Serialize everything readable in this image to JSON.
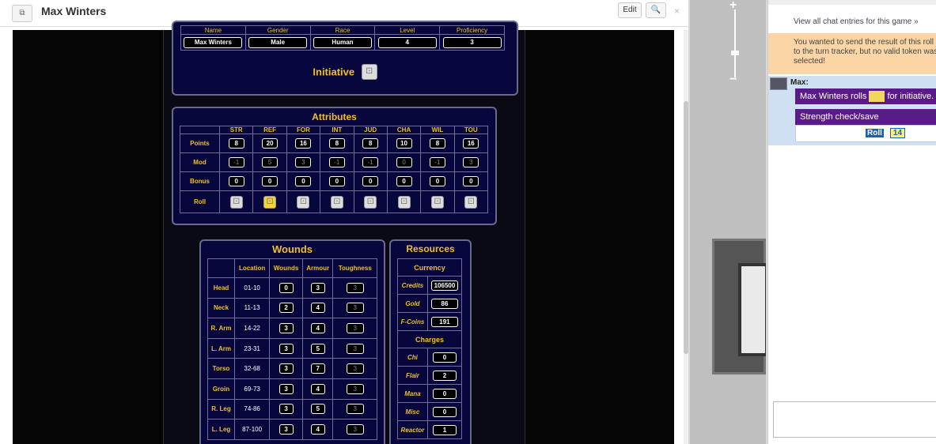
{
  "window": {
    "title": "Max Winters",
    "popout_icon": "⧉",
    "edit_label": "Edit",
    "search_icon": "🔍",
    "close_label": "×"
  },
  "character": {
    "headers": [
      "Name",
      "Gender",
      "Race",
      "Level",
      "Proficiency"
    ],
    "values": [
      "Max Winters",
      "Male",
      "Human",
      "4",
      "3"
    ],
    "initiative_label": "Initiative"
  },
  "attributes": {
    "title": "Attributes",
    "columns": [
      "STR",
      "REF",
      "FOR",
      "INT",
      "JUD",
      "CHA",
      "WIL",
      "TOU"
    ],
    "rows": [
      {
        "label": "Points",
        "values": [
          "8",
          "20",
          "16",
          "8",
          "8",
          "10",
          "8",
          "16"
        ]
      },
      {
        "label": "Mod",
        "values": [
          "-1",
          "5",
          "3",
          "-1",
          "-1",
          "0",
          "-1",
          "3"
        ]
      },
      {
        "label": "Bonus",
        "values": [
          "0",
          "0",
          "0",
          "0",
          "0",
          "0",
          "0",
          "0"
        ]
      }
    ],
    "roll_label": "Roll"
  },
  "wounds": {
    "title": "Wounds",
    "headers": [
      "Location",
      "Wounds",
      "Armour",
      "Toughness"
    ],
    "rows": [
      {
        "part": "Head",
        "loc": "01-10",
        "wounds": "0",
        "armour": "3",
        "tough": "3"
      },
      {
        "part": "Neck",
        "loc": "11-13",
        "wounds": "2",
        "armour": "4",
        "tough": "3"
      },
      {
        "part": "R. Arm",
        "loc": "14-22",
        "wounds": "3",
        "armour": "4",
        "tough": "3"
      },
      {
        "part": "L. Arm",
        "loc": "23-31",
        "wounds": "3",
        "armour": "5",
        "tough": "3"
      },
      {
        "part": "Torso",
        "loc": "32-68",
        "wounds": "3",
        "armour": "7",
        "tough": "3"
      },
      {
        "part": "Groin",
        "loc": "69-73",
        "wounds": "3",
        "armour": "4",
        "tough": "3"
      },
      {
        "part": "R. Leg",
        "loc": "74-86",
        "wounds": "3",
        "armour": "5",
        "tough": "3"
      },
      {
        "part": "L. Leg",
        "loc": "87-100",
        "wounds": "3",
        "armour": "4",
        "tough": "3"
      }
    ]
  },
  "resources": {
    "title": "Resources",
    "currency_header": "Currency",
    "currency": [
      {
        "label": "Credits",
        "value": "106500"
      },
      {
        "label": "Gold",
        "value": "86"
      },
      {
        "label": "F-Coins",
        "value": "191"
      }
    ],
    "charges_header": "Charges",
    "charges": [
      {
        "label": "Chi",
        "value": "0"
      },
      {
        "label": "Flair",
        "value": "2"
      },
      {
        "label": "Mana",
        "value": "0"
      },
      {
        "label": "Misc",
        "value": "0"
      },
      {
        "label": "Reactor",
        "value": "1"
      }
    ]
  },
  "map": {
    "zoom_in": "+",
    "zoom_out": "−"
  },
  "chat": {
    "view_all": "View all chat entries for this game »",
    "warning": [
      "You wanted to send the result of this roll",
      "to the turn tracker, but no valid token was",
      "selected!"
    ],
    "speaker": "Max:",
    "init_prefix": "Max Winters rolls",
    "init_suffix": "for initiative.",
    "strength_title": "Strength check/save",
    "roll_label": "Roll",
    "roll_value": "14"
  },
  "colors": {
    "panel_bg": "#07073e",
    "gold": "#f0c020",
    "chat_purple": "#5a1a8a",
    "warn_bg": "#fbd5a6"
  }
}
